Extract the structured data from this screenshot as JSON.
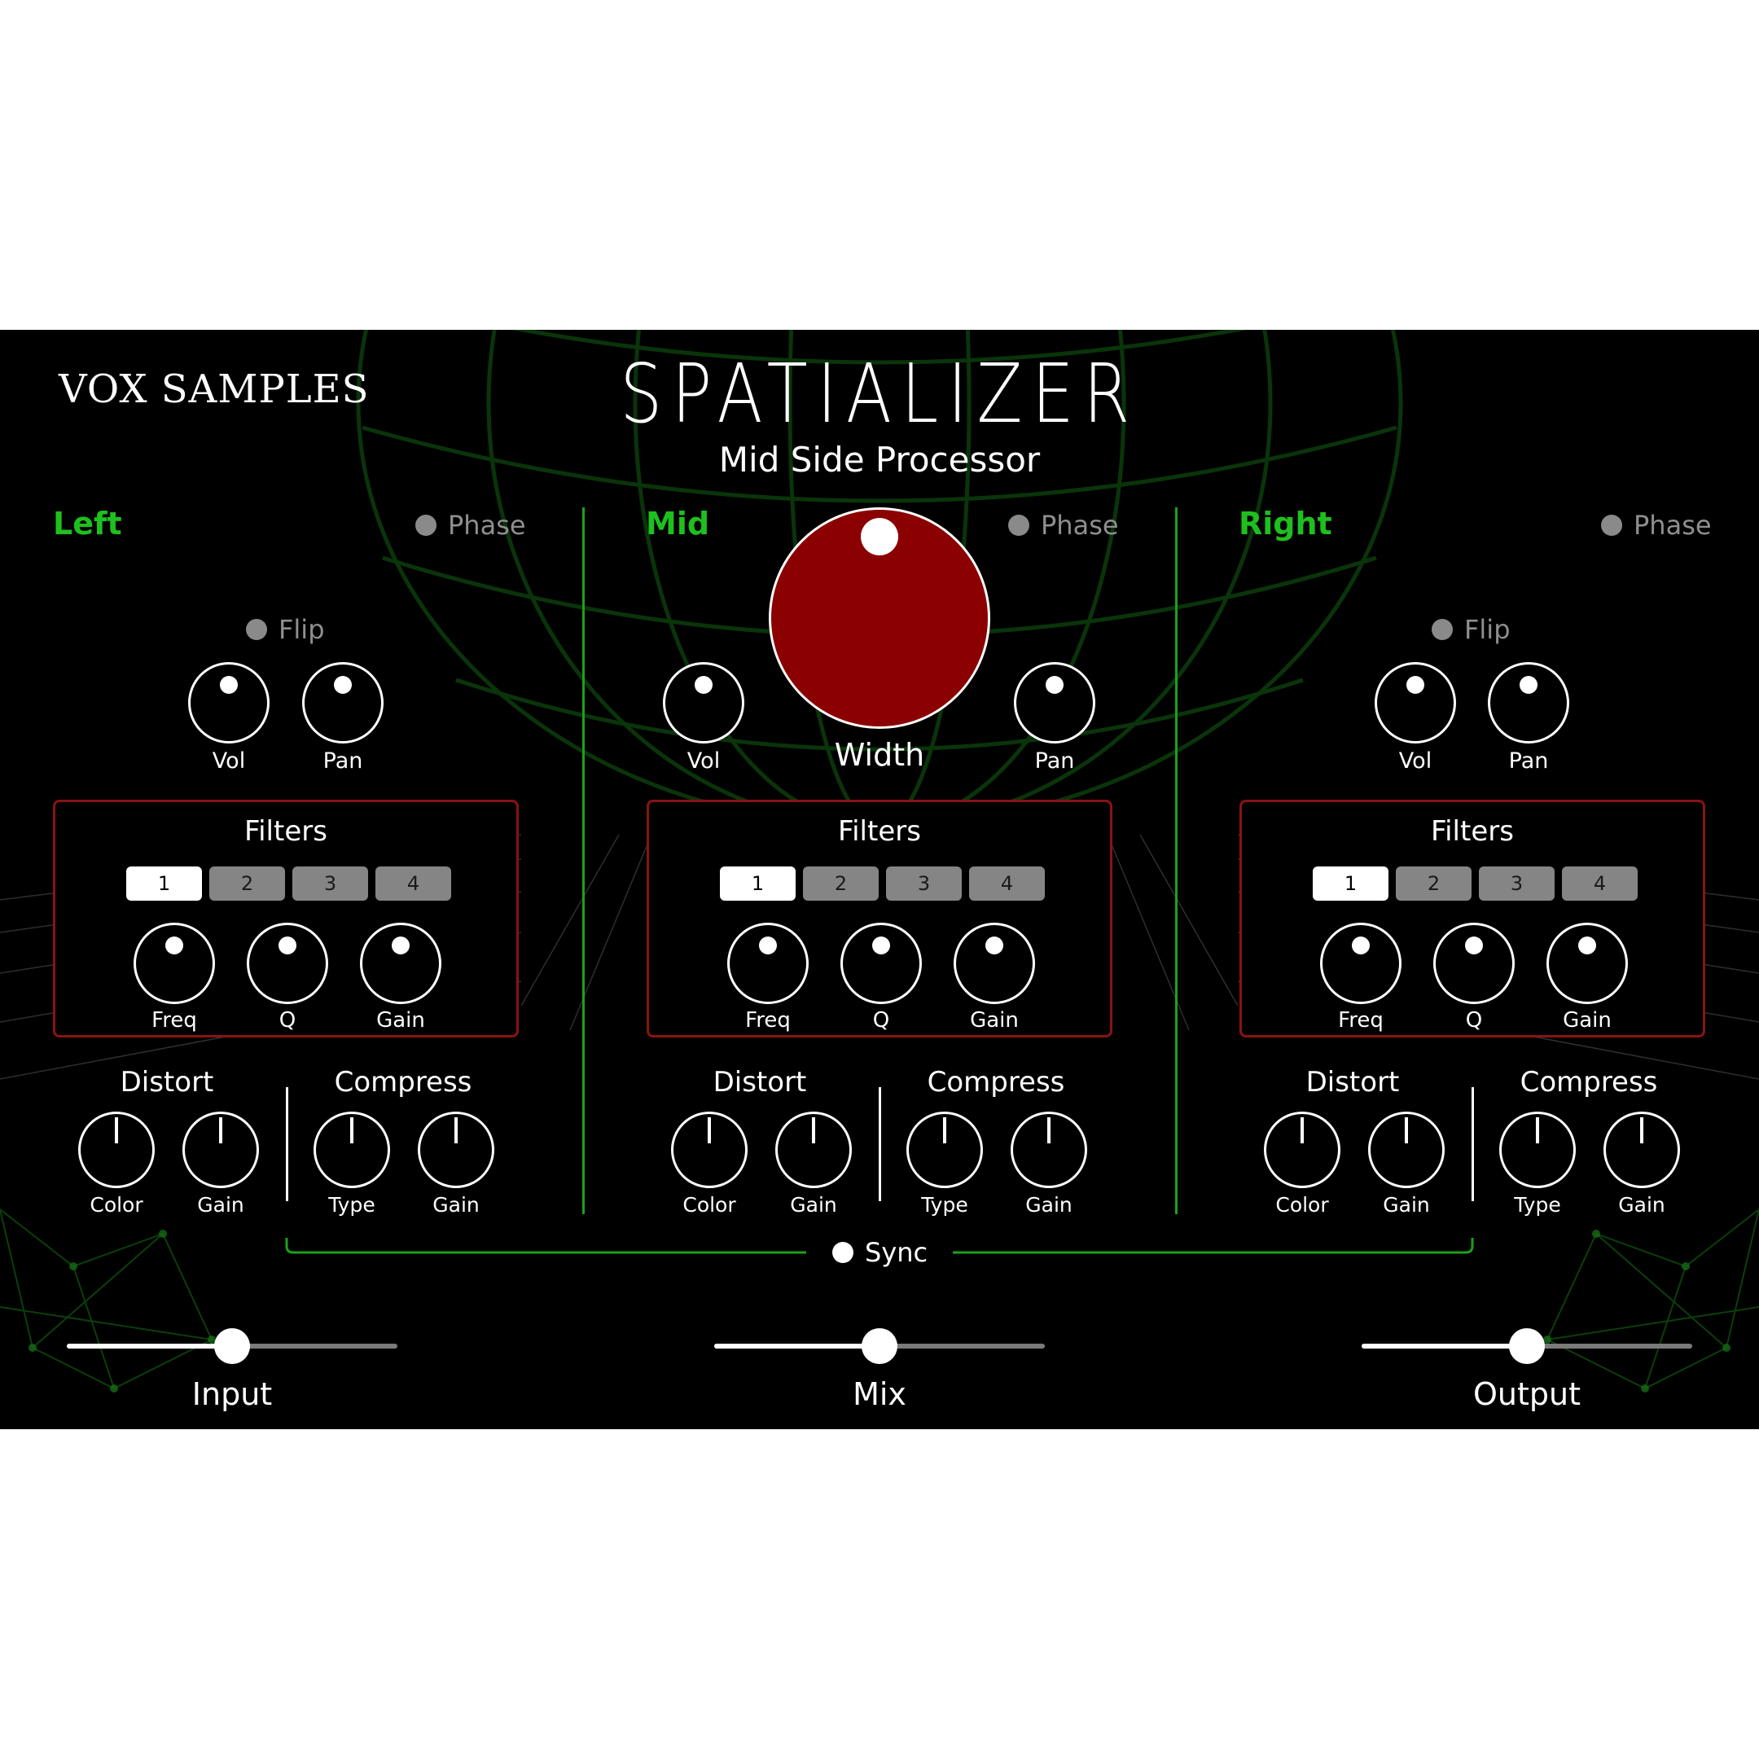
{
  "brand": {
    "logo": "VOX SAMPLES"
  },
  "header": {
    "title": "SPATIALIZER",
    "subtitle": "Mid Side Processor"
  },
  "colors": {
    "accent_green": "#1ec01e",
    "filter_border": "#8a1313",
    "width_knob": "#8b0000"
  },
  "channels": {
    "left": {
      "title": "Left",
      "phase_label": "Phase",
      "flip_label": "Flip",
      "vol_label": "Vol",
      "pan_label": "Pan",
      "filters": {
        "title": "Filters",
        "tabs": [
          "1",
          "2",
          "3",
          "4"
        ],
        "active_tab": "1",
        "knobs": [
          "Freq",
          "Q",
          "Gain"
        ]
      },
      "distort": {
        "title": "Distort",
        "knobs": [
          "Color",
          "Gain"
        ]
      },
      "compress": {
        "title": "Compress",
        "knobs": [
          "Type",
          "Gain"
        ]
      }
    },
    "mid": {
      "title": "Mid",
      "phase_label": "Phase",
      "width_label": "Width",
      "vol_label": "Vol",
      "pan_label": "Pan",
      "filters": {
        "title": "Filters",
        "tabs": [
          "1",
          "2",
          "3",
          "4"
        ],
        "active_tab": "1",
        "knobs": [
          "Freq",
          "Q",
          "Gain"
        ]
      },
      "distort": {
        "title": "Distort",
        "knobs": [
          "Color",
          "Gain"
        ]
      },
      "compress": {
        "title": "Compress",
        "knobs": [
          "Type",
          "Gain"
        ]
      }
    },
    "right": {
      "title": "Right",
      "phase_label": "Phase",
      "flip_label": "Flip",
      "vol_label": "Vol",
      "pan_label": "Pan",
      "filters": {
        "title": "Filters",
        "tabs": [
          "1",
          "2",
          "3",
          "4"
        ],
        "active_tab": "1",
        "knobs": [
          "Freq",
          "Q",
          "Gain"
        ]
      },
      "distort": {
        "title": "Distort",
        "knobs": [
          "Color",
          "Gain"
        ]
      },
      "compress": {
        "title": "Compress",
        "knobs": [
          "Type",
          "Gain"
        ]
      }
    }
  },
  "sync": {
    "label": "Sync"
  },
  "sliders": {
    "input": {
      "label": "Input",
      "value": 0.5
    },
    "mix": {
      "label": "Mix",
      "value": 0.5
    },
    "output": {
      "label": "Output",
      "value": 0.5
    }
  }
}
